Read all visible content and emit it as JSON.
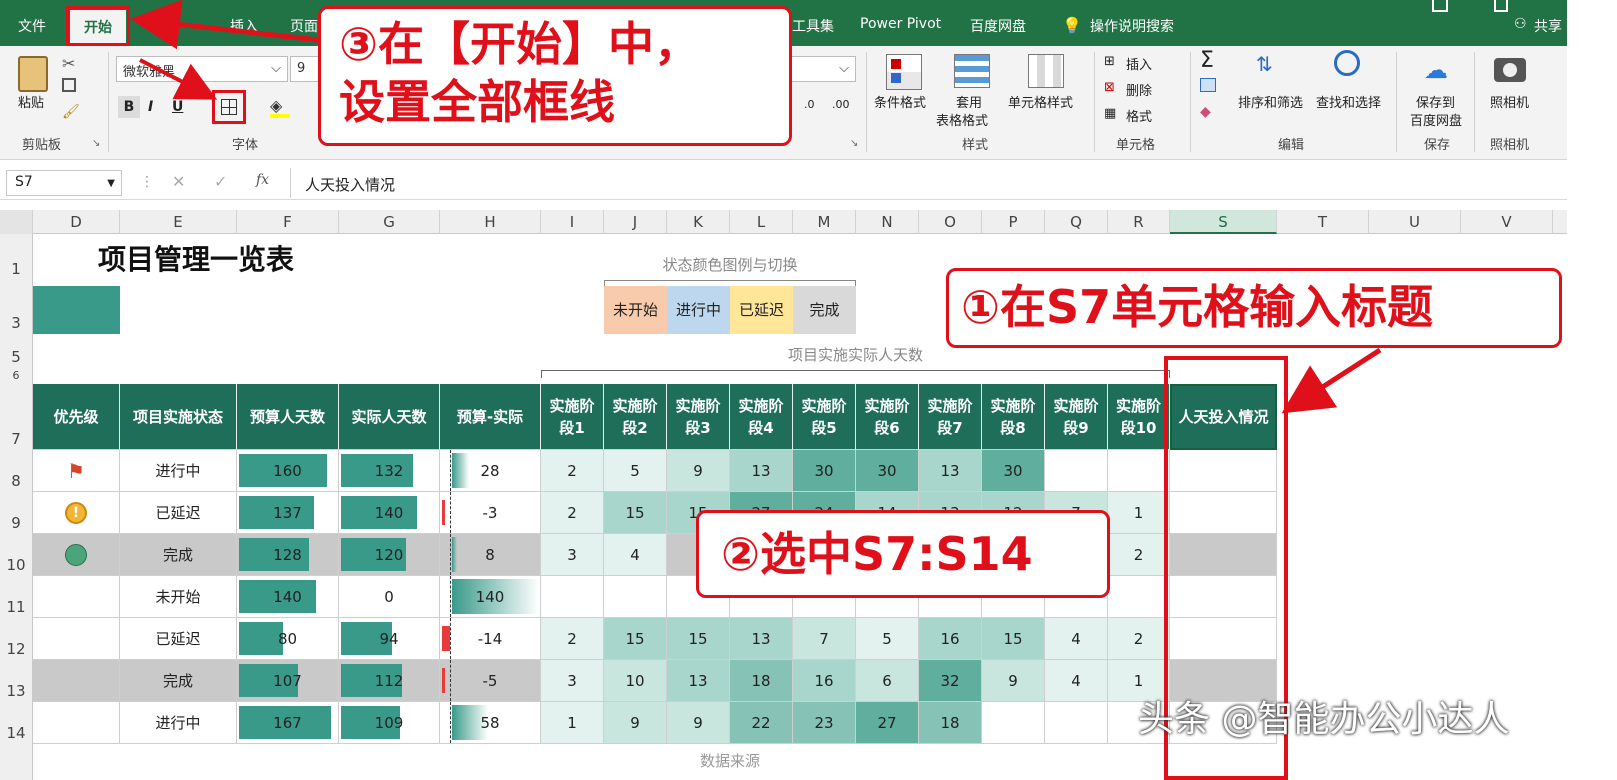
{
  "menu": {
    "items": [
      "文件",
      "开始",
      "插入",
      "页面",
      "工具集",
      "Power Pivot",
      "百度网盘",
      "操作说明搜索",
      "共享"
    ]
  },
  "ribbon": {
    "paste_label": "粘贴",
    "clipboard_group": "剪贴板",
    "font_name": "微软雅黑",
    "font_size": "9",
    "font_group": "字体",
    "bold": "B",
    "italic": "I",
    "underline": "U",
    "conditional_format": "条件格式",
    "table_format_1": "套用",
    "table_format_2": "表格格式",
    "cell_style": "单元格样式",
    "style_group": "样式",
    "insert": "插入",
    "delete": "删除",
    "format": "格式",
    "cells_group": "单元格",
    "sort_filter": "排序和筛选",
    "find_select": "查找和选择",
    "edit_group": "编辑",
    "save_to_1": "保存到",
    "save_to_2": "百度网盘",
    "save_group": "保存",
    "camera": "照相机",
    "camera_group": "照相机",
    "num_inc": ".00",
    "num_dec": ".0"
  },
  "formula_bar": {
    "name_box": "S7",
    "cancel": "✕",
    "enter": "✓",
    "fx": "fx",
    "content": "人天投入情况"
  },
  "columns": [
    "D",
    "E",
    "F",
    "G",
    "H",
    "I",
    "J",
    "K",
    "L",
    "M",
    "N",
    "O",
    "P",
    "Q",
    "R",
    "S",
    "T",
    "U",
    "V"
  ],
  "rows": [
    "1",
    "3",
    "5",
    "6",
    "7",
    "8",
    "9",
    "10",
    "11",
    "12",
    "13",
    "14"
  ],
  "sheet": {
    "title": "项目管理一览表",
    "legend_title": "状态颜色图例与切换",
    "legend": [
      "未开始",
      "进行中",
      "已延迟",
      "完成"
    ],
    "legend_colors": [
      "#f8cbad",
      "#bdd7ee",
      "#ffe699",
      "#d9d9d9"
    ],
    "stage_caption": "项目实施实际人天数",
    "footer_partial": "数据来源",
    "headers": [
      "优先级",
      "项目实施状态",
      "预算人天数",
      "实际人天数",
      "预算-实际",
      "实施阶段1",
      "实施阶段2",
      "实施阶段3",
      "实施阶段4",
      "实施阶段5",
      "实施阶段6",
      "实施阶段7",
      "实施阶段8",
      "实施阶段9",
      "实施阶段10",
      "人天投入情况"
    ],
    "data": [
      {
        "priority": "flag-icon",
        "status": "进行中",
        "budget": "160",
        "actual": "132",
        "diff": "28",
        "stages": [
          "2",
          "5",
          "9",
          "13",
          "30",
          "30",
          "13",
          "30",
          "",
          ""
        ]
      },
      {
        "priority": "warning-icon",
        "status": "已延迟",
        "budget": "137",
        "actual": "140",
        "diff": "-3",
        "stages": [
          "2",
          "15",
          "15",
          "27",
          "24",
          "14",
          "13",
          "12",
          "7",
          "1"
        ]
      },
      {
        "priority": "circle-icon",
        "status": "完成",
        "budget": "128",
        "actual": "120",
        "diff": "8",
        "stages": [
          "3",
          "4",
          "",
          "",
          "",
          "",
          "",
          "",
          "",
          "2"
        ]
      },
      {
        "priority": "",
        "status": "未开始",
        "budget": "140",
        "actual": "0",
        "diff": "140",
        "stages": [
          "",
          "",
          "",
          "",
          "",
          "",
          "",
          "",
          "",
          ""
        ]
      },
      {
        "priority": "",
        "status": "已延迟",
        "budget": "80",
        "actual": "94",
        "diff": "-14",
        "stages": [
          "2",
          "15",
          "15",
          "13",
          "7",
          "5",
          "16",
          "15",
          "4",
          "2"
        ]
      },
      {
        "priority": "",
        "status": "完成",
        "budget": "107",
        "actual": "112",
        "diff": "-5",
        "stages": [
          "3",
          "10",
          "13",
          "18",
          "16",
          "6",
          "32",
          "9",
          "4",
          "1"
        ]
      },
      {
        "priority": "",
        "status": "进行中",
        "budget": "167",
        "actual": "109",
        "diff": "58",
        "stages": [
          "1",
          "9",
          "9",
          "22",
          "23",
          "27",
          "18",
          "",
          "",
          ""
        ]
      }
    ]
  },
  "annotations": {
    "step1": "①在S7单元格输入标题",
    "step2": "②选中S7:S14",
    "step3_line1": "③在【开始】中，",
    "step3_line2": "设置全部框线"
  },
  "watermark": "头条 @智能办公小达人",
  "colors": {
    "excel_green": "#217346",
    "header_teal": "#1f6e5a",
    "bar_teal": "#3a9a8a",
    "annotation_red": "#e0101a"
  }
}
